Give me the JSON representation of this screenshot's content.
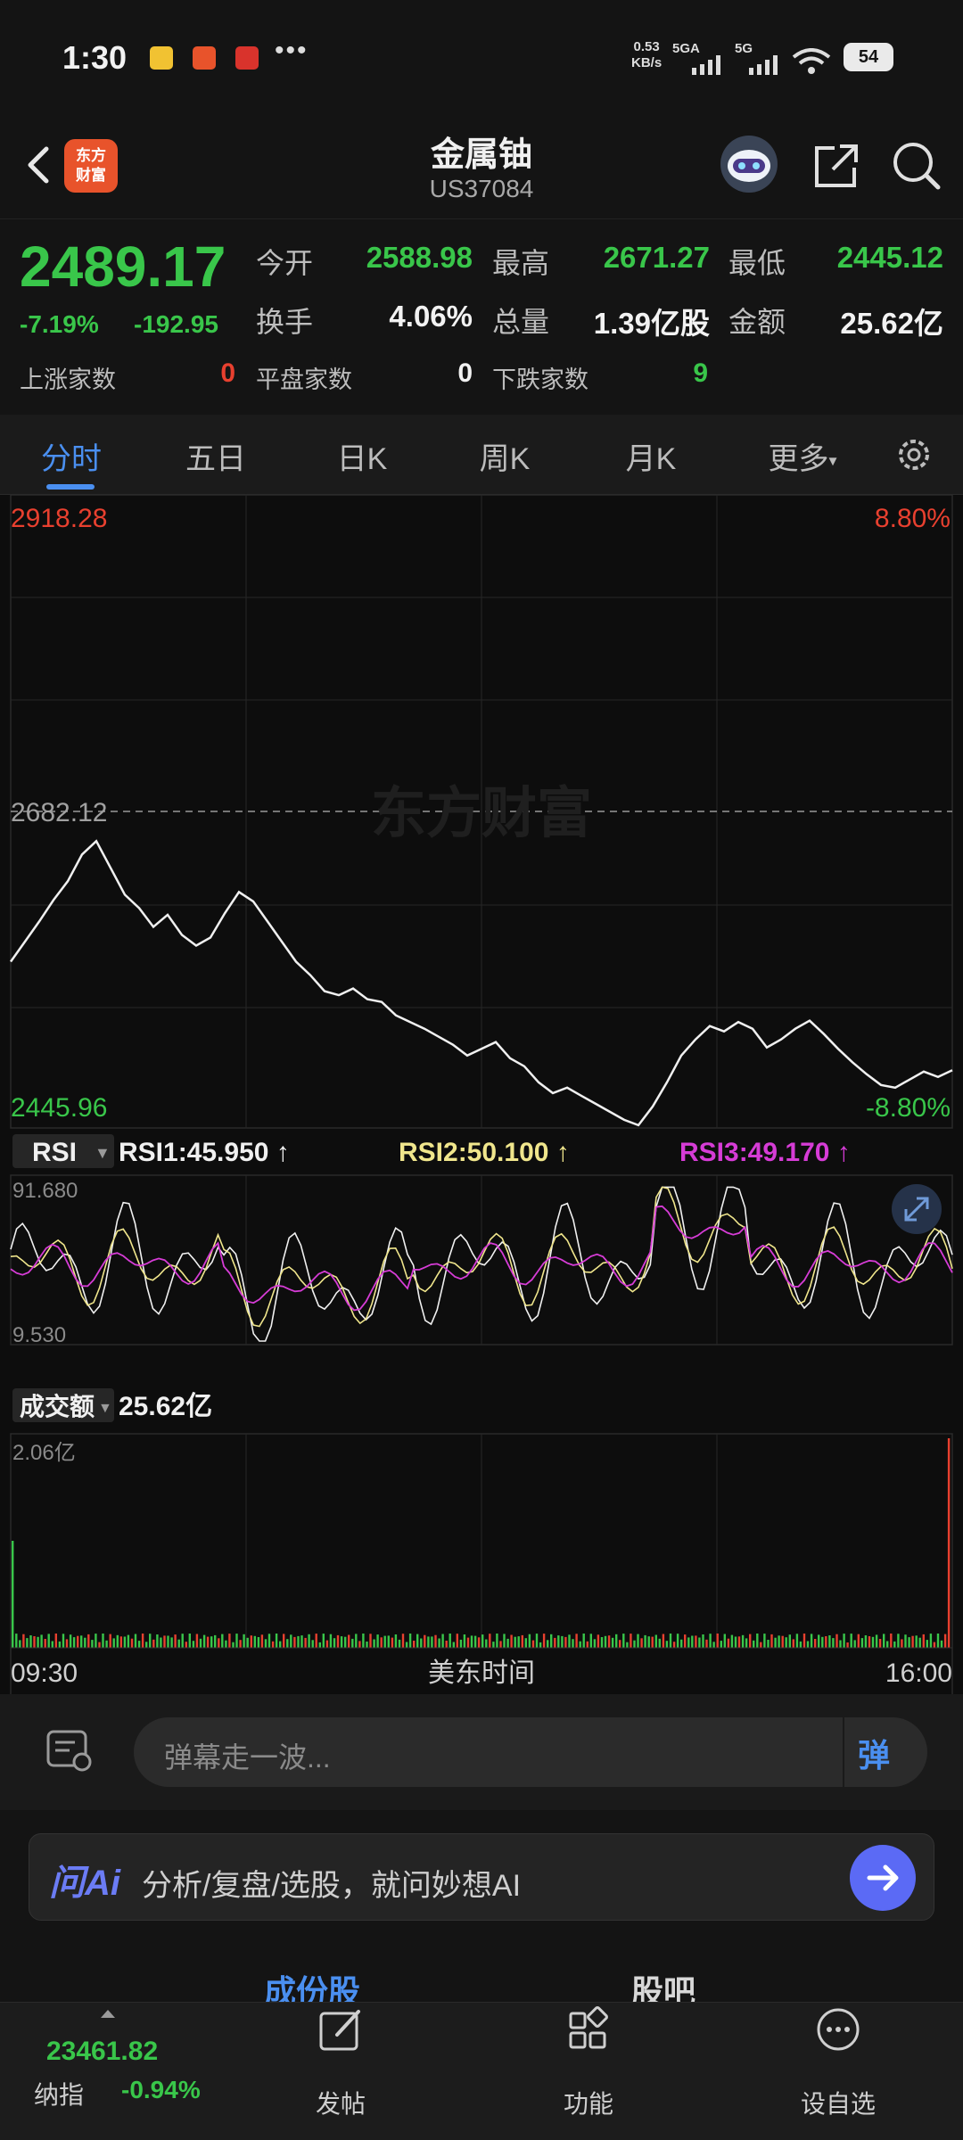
{
  "status": {
    "time": "1:30",
    "speed": "0.53",
    "speed_unit": "KB/s",
    "sig1": "5GA",
    "sig2": "5G",
    "battery": "54"
  },
  "header": {
    "logo_text": "东方财富",
    "title": "金属铀",
    "code": "US37084"
  },
  "quote": {
    "price": "2489.17",
    "change_pct": "-7.19%",
    "change": "-192.95",
    "open_label": "今开",
    "open": "2588.98",
    "high_label": "最高",
    "high": "2671.27",
    "low_label": "最低",
    "low": "2445.12",
    "turnover_label": "换手",
    "turnover": "4.06%",
    "volume_label": "总量",
    "volume": "1.39亿股",
    "amount_label": "金额",
    "amount": "25.62亿",
    "up_label": "上涨家数",
    "up": "0",
    "flat_label": "平盘家数",
    "flat": "0",
    "down_label": "下跌家数",
    "down": "9"
  },
  "tabs": [
    "分时",
    "五日",
    "日K",
    "周K",
    "月K",
    "更多"
  ],
  "chart": {
    "price_top": "2918.28",
    "price_mid": "2682.12",
    "price_bottom": "2445.96",
    "pct_top": "8.80%",
    "pct_bottom": "-8.80%",
    "watermark": "东方财富",
    "rsi_name": "RSI",
    "rsi1": "RSI1:45.950 ↑",
    "rsi2": "RSI2:50.100 ↑",
    "rsi3": "RSI3:49.170 ↑",
    "rsi_top": "91.680",
    "rsi_bottom": "9.530",
    "amount_name": "成交额",
    "amount_value": "25.62亿",
    "amount_top": "2.06亿",
    "time_start": "09:30",
    "time_mid": "美东时间",
    "time_end": "16:00"
  },
  "chart_data": {
    "type": "line",
    "y_range": [
      2445.96,
      2918.28
    ],
    "prev_close": 2682.12,
    "price_series": [
      2570,
      2585,
      2600,
      2616,
      2630,
      2650,
      2660,
      2640,
      2620,
      2610,
      2596,
      2605,
      2590,
      2582,
      2588,
      2606,
      2622,
      2615,
      2600,
      2585,
      2570,
      2560,
      2548,
      2545,
      2550,
      2542,
      2540,
      2530,
      2525,
      2520,
      2514,
      2508,
      2500,
      2505,
      2510,
      2498,
      2492,
      2480,
      2472,
      2476,
      2470,
      2464,
      2458,
      2452,
      2448,
      2462,
      2480,
      2500,
      2512,
      2522,
      2518,
      2525,
      2520,
      2506,
      2512,
      2520,
      2526,
      2516,
      2505,
      2495,
      2486,
      2478,
      2476,
      2482,
      2488,
      2484,
      2489
    ],
    "rsi_range": [
      9.53,
      91.68
    ],
    "rsi": {
      "rsi1": 45.95,
      "rsi2": 50.1,
      "rsi3": 49.17
    },
    "amount_max": "2.06亿"
  },
  "danmu": {
    "placeholder": "弹幕走一波...",
    "button": "弹"
  },
  "ai": {
    "logo": "问Ai",
    "text": "分析/复盘/选股，就问妙想AI"
  },
  "sub_tabs": [
    "成份股",
    "股吧"
  ],
  "bottom": {
    "index_value": "23461.82",
    "index_name": "纳指",
    "index_change": "-0.94%",
    "nav": [
      "发帖",
      "功能",
      "设自选"
    ]
  },
  "colors": {
    "up": "#e8402f",
    "down": "#39c64a",
    "accent": "#4a8ff0",
    "rsi2": "#f0e68c",
    "rsi3": "#d63cd6"
  }
}
